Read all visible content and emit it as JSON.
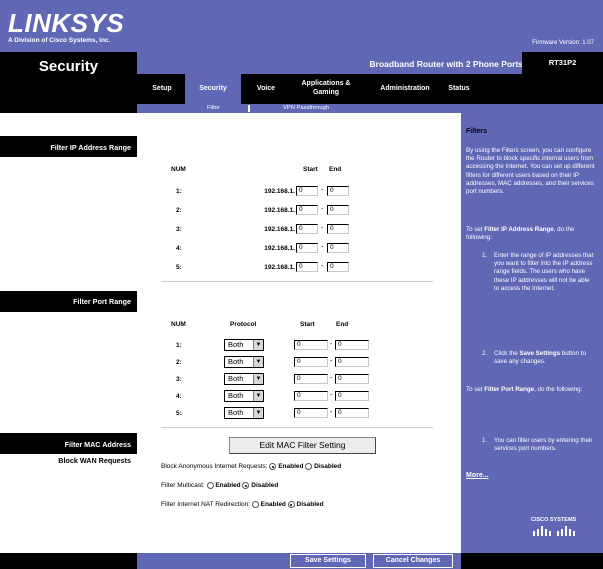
{
  "brand": {
    "logo": "LINKSYS",
    "subtitle": "A Division of Cisco Systems, Inc.",
    "firmware": "Firmware Version: 1.07"
  },
  "header": {
    "page_title": "Security",
    "product_name": "Broadband Router with 2 Phone Ports",
    "model": "RT31P2"
  },
  "tabs": [
    {
      "label": "Setup"
    },
    {
      "label": "Security"
    },
    {
      "label": "Voice"
    },
    {
      "label": "Applications & Gaming"
    },
    {
      "label": "Administration"
    },
    {
      "label": "Status"
    }
  ],
  "subtabs": [
    {
      "label": "Filter"
    },
    {
      "label": "VPN Passthrough"
    }
  ],
  "sections": {
    "filter_ip": "Filter IP Address Range",
    "filter_port": "Filter Port Range",
    "filter_mac": "Filter MAC Address",
    "block_wan": "Block WAN Requests"
  },
  "ip_table": {
    "headers": {
      "num": "NUM",
      "start": "Start",
      "end": "End"
    },
    "prefix": "192.168.1.",
    "rows": [
      {
        "num": "1:",
        "start": "0",
        "end": "0"
      },
      {
        "num": "2:",
        "start": "0",
        "end": "0"
      },
      {
        "num": "3:",
        "start": "0",
        "end": "0"
      },
      {
        "num": "4:",
        "start": "0",
        "end": "0"
      },
      {
        "num": "5:",
        "start": "0",
        "end": "0"
      }
    ]
  },
  "port_table": {
    "headers": {
      "num": "NUM",
      "protocol": "Protocol",
      "start": "Start",
      "end": "End"
    },
    "rows": [
      {
        "num": "1:",
        "protocol": "Both",
        "start": "0",
        "end": "0"
      },
      {
        "num": "2:",
        "protocol": "Both",
        "start": "0",
        "end": "0"
      },
      {
        "num": "3:",
        "protocol": "Both",
        "start": "0",
        "end": "0"
      },
      {
        "num": "4:",
        "protocol": "Both",
        "start": "0",
        "end": "0"
      },
      {
        "num": "5:",
        "protocol": "Both",
        "start": "0",
        "end": "0"
      }
    ]
  },
  "mac_button": "Edit MAC Filter Setting",
  "options": {
    "block_anon": {
      "label": "Block Anonymous Internet Requests:",
      "enabled": "Enabled",
      "disabled": "Disabled",
      "selected": "enabled"
    },
    "filter_multicast": {
      "label": "Filter Multicast:",
      "enabled": "Enabled",
      "disabled": "Disabled",
      "selected": "disabled"
    },
    "filter_nat": {
      "label": "Filter Internet NAT Redirection:",
      "enabled": "Enabled",
      "disabled": "Disabled",
      "selected": "disabled"
    }
  },
  "help": {
    "title": "Filters",
    "intro": "By using the Filters screen, you can configure the Router to block specific internal users from accessing the Internet. You can set up different filters for different users based on their IP addresses, MAC addresses, and their services port numbers.",
    "ip_intro_prefix": "To set",
    "ip_intro_bold": "Filter IP Address Range",
    "ip_intro_suffix": ", do the following:",
    "ip_step1": "Enter the range of IP addresses that you want to filter into the IP address range fields. The users who have these IP addresses will not be able to access the Internet.",
    "ip_step2_prefix": "Click the",
    "ip_step2_bold": "Save Settings",
    "ip_step2_suffix": "button to save any changes.",
    "port_intro_prefix": "To set",
    "port_intro_bold": "Filter Port Range",
    "port_intro_suffix": ", do the following:",
    "port_step1": "You can filter users by entering their services port numbers.",
    "more": "More...",
    "cisco": "CISCO SYSTEMS"
  },
  "footer": {
    "save": "Save Settings",
    "cancel": "Cancel Changes"
  },
  "colors": {
    "brand_blue": "#6067b4",
    "black": "#000000"
  }
}
